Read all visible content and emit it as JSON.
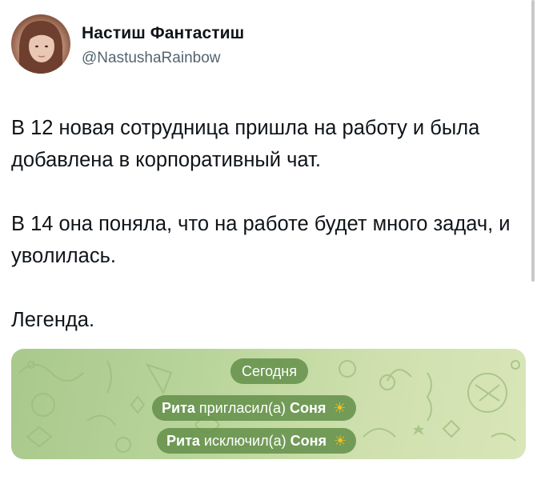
{
  "author": {
    "name": "Настиш Фантастиш",
    "handle": "@NastushaRainbow"
  },
  "tweet": {
    "paragraphs": [
      "В 12 новая сотрудница пришла на работу и была добавлена в корпоративный чат.",
      "В 14 она поняла, что на работе будет много задач, и уволилась.",
      "Легенда."
    ]
  },
  "media": {
    "date_label": "Сегодня",
    "events": [
      {
        "actor": "Рита",
        "action": "пригласил(а)",
        "target": "Соня",
        "emoji": "☀"
      },
      {
        "actor": "Рита",
        "action": "исключил(а)",
        "target": "Соня",
        "emoji": "☀"
      }
    ]
  },
  "colors": {
    "text": "#0f1419",
    "handle": "#536471",
    "chat_background": "#b8d49a",
    "pill": "#5f8c46"
  },
  "icons": {
    "avatar": "profile-photo",
    "emoji": "sun-emoji"
  }
}
